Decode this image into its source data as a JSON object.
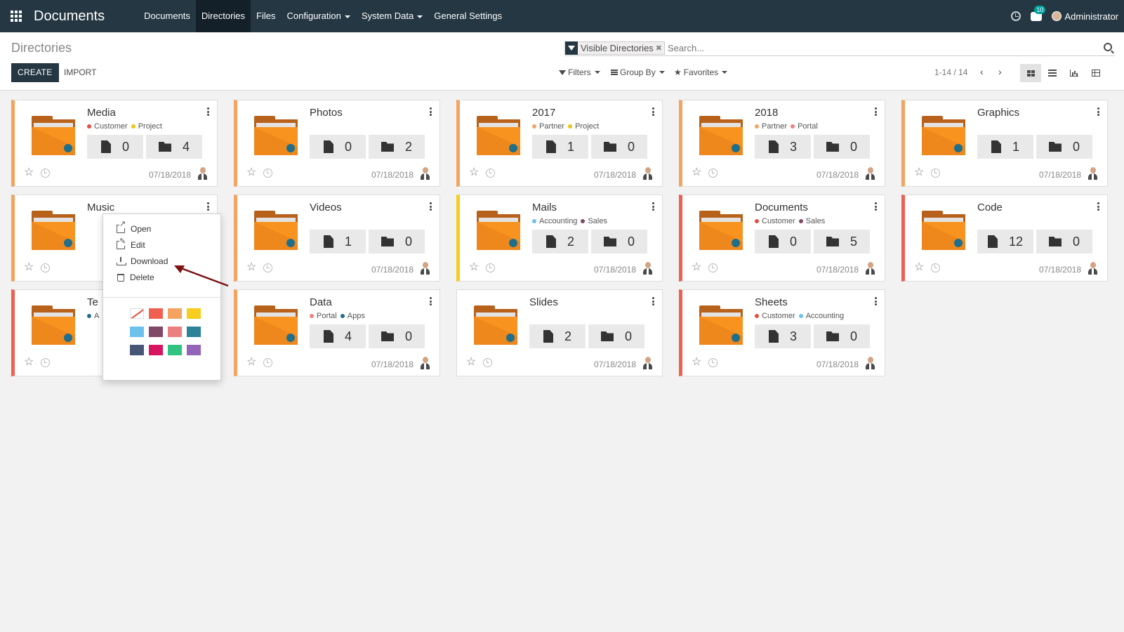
{
  "navbar": {
    "brand": "Documents",
    "menu": [
      {
        "label": "Documents",
        "dropdown": false,
        "active": false
      },
      {
        "label": "Directories",
        "dropdown": false,
        "active": true
      },
      {
        "label": "Files",
        "dropdown": false,
        "active": false
      },
      {
        "label": "Configuration",
        "dropdown": true,
        "active": false
      },
      {
        "label": "System Data",
        "dropdown": true,
        "active": false
      },
      {
        "label": "General Settings",
        "dropdown": false,
        "active": false
      }
    ],
    "chat_badge": "10",
    "user": "Administrator"
  },
  "control_panel": {
    "breadcrumb": "Directories",
    "search": {
      "facet": "Visible Directories",
      "facet_remove": "✖",
      "placeholder": "Search..."
    },
    "create_label": "CREATE",
    "import_label": "IMPORT",
    "filters_label": "Filters",
    "groupby_label": "Group By",
    "favorites_label": "Favorites",
    "pager": "1-14 / 14",
    "prev": "‹",
    "next": "›"
  },
  "cards": [
    {
      "name": "Media",
      "tags": [
        {
          "label": "Customer",
          "color": "#e74c3c"
        },
        {
          "label": "Project",
          "color": "#f1c40f"
        }
      ],
      "files": "0",
      "folders": "4",
      "date": "07/18/2018",
      "border": "#f4a460"
    },
    {
      "name": "Photos",
      "tags": [],
      "files": "0",
      "folders": "2",
      "date": "07/18/2018",
      "border": "#f4a460"
    },
    {
      "name": "2017",
      "tags": [
        {
          "label": "Partner",
          "color": "#f4a460"
        },
        {
          "label": "Project",
          "color": "#f1c40f"
        }
      ],
      "files": "1",
      "folders": "0",
      "date": "07/18/2018",
      "border": "#f4a460"
    },
    {
      "name": "2018",
      "tags": [
        {
          "label": "Partner",
          "color": "#f4a460"
        },
        {
          "label": "Portal",
          "color": "#f08080"
        }
      ],
      "files": "3",
      "folders": "0",
      "date": "07/18/2018",
      "border": "#f4a460"
    },
    {
      "name": "Graphics",
      "tags": [],
      "files": "1",
      "folders": "0",
      "date": "07/18/2018",
      "border": "#f4a460"
    },
    {
      "name": "Music",
      "tags": [],
      "files": "",
      "folders": "",
      "date": "",
      "border": "#f4a460"
    },
    {
      "name": "Videos",
      "tags": [],
      "files": "1",
      "folders": "0",
      "date": "07/18/2018",
      "border": "#f4a460"
    },
    {
      "name": "Mails",
      "tags": [
        {
          "label": "Accounting",
          "color": "#6cc1ed"
        },
        {
          "label": "Sales",
          "color": "#814968"
        }
      ],
      "files": "2",
      "folders": "0",
      "date": "07/18/2018",
      "border": "#f7cd1f"
    },
    {
      "name": "Documents",
      "tags": [
        {
          "label": "Customer",
          "color": "#e74c3c"
        },
        {
          "label": "Sales",
          "color": "#814968"
        }
      ],
      "files": "0",
      "folders": "5",
      "date": "07/18/2018",
      "border": "#f06050"
    },
    {
      "name": "Code",
      "tags": [],
      "files": "12",
      "folders": "0",
      "date": "07/18/2018",
      "border": "#f06050"
    },
    {
      "name": "Te",
      "tags": [
        {
          "label": "A",
          "color": "#1f6f8b"
        }
      ],
      "files": "",
      "folders": "",
      "date": "",
      "border": "#f06050"
    },
    {
      "name": "Data",
      "tags": [
        {
          "label": "Portal",
          "color": "#f08080"
        },
        {
          "label": "Apps",
          "color": "#1f6f8b"
        }
      ],
      "files": "4",
      "folders": "0",
      "date": "07/18/2018",
      "border": "#f4a460"
    },
    {
      "name": "Slides",
      "tags": [],
      "files": "2",
      "folders": "0",
      "date": "07/18/2018",
      "border": "#ffffff"
    },
    {
      "name": "Sheets",
      "tags": [
        {
          "label": "Customer",
          "color": "#e74c3c"
        },
        {
          "label": "Accounting",
          "color": "#6cc1ed"
        }
      ],
      "files": "3",
      "folders": "0",
      "date": "07/18/2018",
      "border": "#f06050"
    }
  ],
  "dropdown": {
    "items": [
      {
        "label": "Open",
        "icon": "external-link-icon"
      },
      {
        "label": "Edit",
        "icon": "edit-icon"
      },
      {
        "label": "Download",
        "icon": "download-icon"
      },
      {
        "label": "Delete",
        "icon": "trash-icon"
      }
    ],
    "colors": [
      "none",
      "#f06050",
      "#f4a460",
      "#f7cd1f",
      "#6cc1ed",
      "#814968",
      "#eb7e7f",
      "#2c8397",
      "#475577",
      "#d6145f",
      "#30c381",
      "#9365b8"
    ]
  },
  "annotation": {
    "arrow_color": "#7a1212"
  }
}
